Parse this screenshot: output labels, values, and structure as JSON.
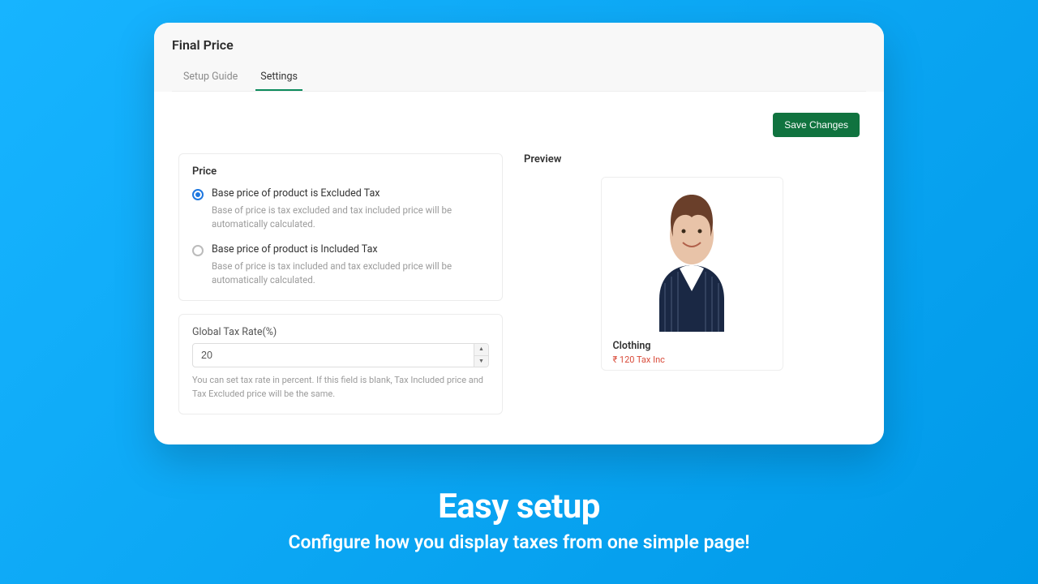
{
  "header": {
    "title": "Final Price"
  },
  "tabs": {
    "guide": "Setup Guide",
    "settings": "Settings"
  },
  "actions": {
    "save": "Save Changes"
  },
  "price_panel": {
    "title": "Price",
    "opt1_label": "Base price of product is Excluded Tax",
    "opt1_desc": "Base of price is tax excluded and tax included price will be automatically calculated.",
    "opt2_label": "Base price of product is Included Tax",
    "opt2_desc": "Base of price is tax included and tax excluded price will be automatically calculated."
  },
  "tax_panel": {
    "label": "Global Tax Rate(%)",
    "value": "20",
    "help": "You can set tax rate in percent. If this field is blank, Tax Included price and Tax Excluded price will be the same."
  },
  "preview": {
    "title": "Preview",
    "product_name": "Clothing",
    "product_price": "₹ 120 Tax Inc"
  },
  "promo": {
    "main": "Easy setup",
    "sub": "Configure how you display taxes from one simple page!"
  }
}
